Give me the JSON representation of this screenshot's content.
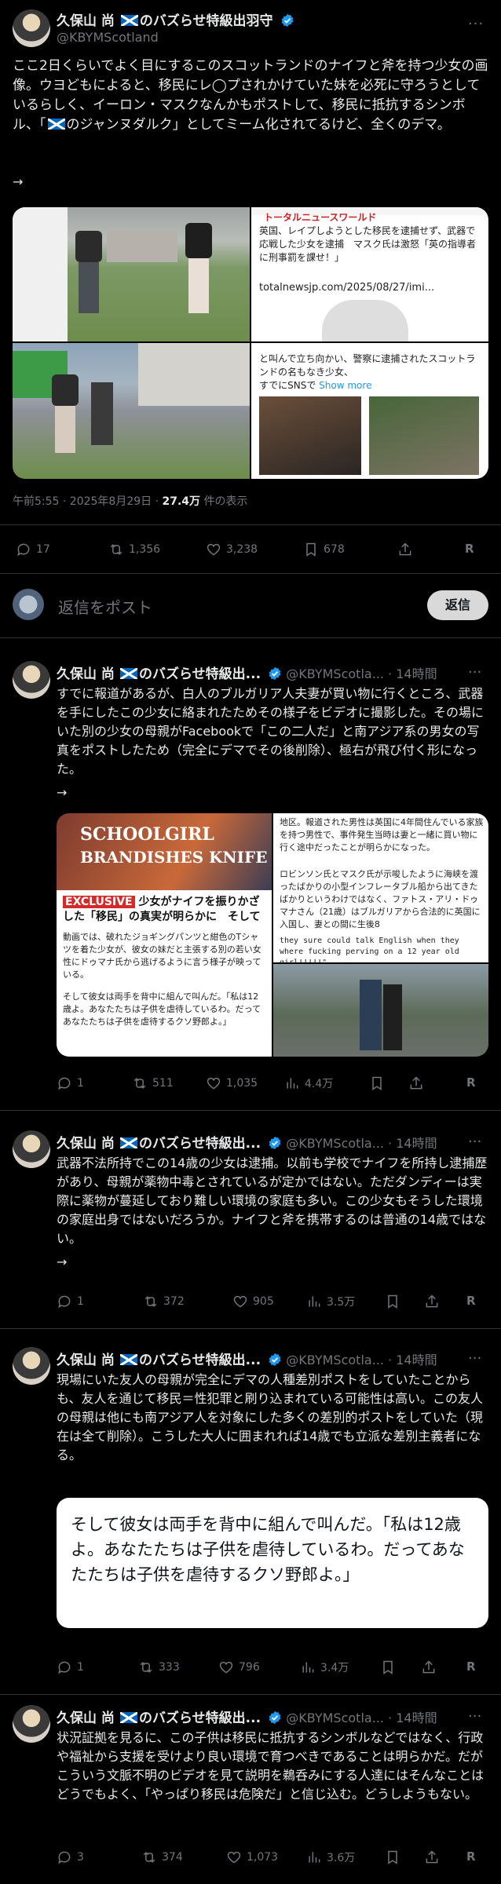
{
  "main_post": {
    "author_name": "久保山 尚 🏴󠁧󠁢󠁳󠁣󠁴󠁿のバズらせ特級出羽守",
    "author_name_plain": "久保山 尚",
    "author_name_suffix": "のバズらせ特級出羽守",
    "handle": "@KBYMScotland",
    "text": "ここ2日くらいでよく目にするこのスコットランドのナイフと斧を持つ少女の画像。ウヨどもによると、移民にレ◯プされかけていた妹を必死に守ろうとしているらしく、イーロン・マスクなんかもポストして、移民に抵抗するシンボル、「🏴󠁧󠁢󠁳󠁣󠁴󠁿のジャンヌダルク」としてミーム化されてるけど、全くのデマ。",
    "text_before_flag": "ここ2日くらいでよく目にするこのスコットランドのナイフと斧を持つ少女の画像。ウヨどもによると、移民にレ◯プされかけていた妹を必死に守ろうとしているらしく、イーロン・マスクなんかもポストして、移民に抵抗するシンボル、「",
    "text_after_flag": "のジャンヌダルク」としてミーム化されてるけど、全くのデマ。",
    "arrow": "→",
    "media_right_top": {
      "header": "トータルニュースワールド",
      "text": "英国、レイプしようとした移民を逮捕せず、武器で応戦した少女を逮捕　マスク氏は激怒「英の指導者に刑事罰を課せ！」",
      "link": "totalnewsjp.com/2025/08/27/imi..."
    },
    "media_right_bottom": {
      "text": "と叫んで立ち向かい、警察に逮捕されたスコットランドの名もなき少女、",
      "text2": "すでにSNSで",
      "show_more": "Show more"
    },
    "time": "午前5:55 · 2025年8月29日 ·",
    "views_count": "27.4万",
    "views_label": "件の表示",
    "stats": {
      "replies": "17",
      "reposts": "1,356",
      "likes": "3,238",
      "bookmarks": "678"
    }
  },
  "reply_box": {
    "placeholder": "返信をポスト",
    "button": "返信"
  },
  "replies": [
    {
      "author_name": "久保山 尚",
      "author_suffix": "のバズらせ特級出...",
      "handle": "@KBYMScotla...",
      "time": "· 14時間",
      "text": "すでに報道があるが、白人のブルガリア人夫妻が買い物に行くところ、武器を手にしたこの少女に絡まれたためその様子をビデオに撮影した。その場にいた別の少女の母親がFacebookで「この二人だ」と南アジア系の男女の写真をポストしたため（完全にデマでその後削除）、極右が飛び付く形になった。",
      "arrow": "→",
      "media": {
        "headline1": "SCHOOLGIRL",
        "headline2": "BRANDISHES KNIFE",
        "exclusive": "EXCLUSIVE",
        "exclusive_text": "少女がナイフを振りかざした「移民」の真実が明らかに　そしてマスクとロビンソ",
        "left_text1": "動画では、破れたジョギングパンツと紺色のTシャツを着た少女が、彼女の妹だと主張する別の若い女性にドゥマナ氏から逃げるように言う様子が映っている。",
        "left_text2": "そして彼女は両手を背中に組んで叫んだ。「私は12歳よ。あなたたちは子供を虐待しているわ。だってあなたたちは子供を虐待するクソ野郎よ。」",
        "right_text1": "地区。報道された男性は英国に4年間住んでいる家族を持つ男性で、事件発生当時は妻と一緒に買い物に行く途中だったことが明らかになった。",
        "right_text2": "ロビンソン氏とマスク氏が示唆したように海峡を渡ったばかりの小型インフレータブル船から出てきたばかりというわけではなく、ファトス・アリ・ドゥマナさん（21歳）はブルガリアから合法的に英国に入国し、妻との間に生後8",
        "right_text3": "they sure could talk English when they where fucking perving on a 12 year old girl!!!!!\""
      },
      "stats": {
        "replies": "1",
        "reposts": "511",
        "likes": "1,035",
        "views": "4.4万"
      }
    },
    {
      "author_name": "久保山 尚",
      "author_suffix": "のバズらせ特級出...",
      "handle": "@KBYMScotla...",
      "time": "· 14時間",
      "text": "武器不法所持でこの14歳の少女は逮捕。以前も学校でナイフを所持し逮捕歴があり、母親が薬物中毒とされているが定かではない。ただダンディーは実際に薬物が蔓延しており難しい環境の家庭も多い。この少女もそうした環境の家庭出身ではないだろうか。ナイフと斧を携帯するのは普通の14歳ではない。",
      "arrow": "→",
      "stats": {
        "replies": "1",
        "reposts": "372",
        "likes": "905",
        "views": "3.5万"
      }
    },
    {
      "author_name": "久保山 尚",
      "author_suffix": "のバズらせ特級出...",
      "handle": "@KBYMScotla...",
      "time": "· 14時間",
      "text": "現場にいた友人の母親が完全にデマの人種差別ポストをしていたことからも、友人を通じて移民＝性犯罪と刷り込まれている可能性は高い。この友人の母親は他にも南アジア人を対象にした多くの差別的ポストをしていた（現在は全て削除）。こうした大人に囲まれれば14歳でも立派な差別主義者になる。",
      "quote": "そして彼女は両手を背中に組んで叫んだ。「私は12歳よ。あなたたちは子供を虐待しているわ。だってあなたたちは子供を虐待するクソ野郎よ。」",
      "stats": {
        "replies": "1",
        "reposts": "333",
        "likes": "796",
        "views": "3.4万"
      }
    },
    {
      "author_name": "久保山 尚",
      "author_suffix": "のバズらせ特級出...",
      "handle": "@KBYMScotla...",
      "time": "· 14時間",
      "text": "状況証拠を見るに、この子供は移民に抵抗するシンボルなどではなく、行政や福祉から支援を受けより良い環境で育つべきであることは明らかだ。だがこういう文脈不明のビデオを見て説明を鵜呑みにする人達にはそんなことはどうでもよく、「やっぱり移民は危険だ」と信じ込む。どうしようもない。",
      "stats": {
        "replies": "3",
        "reposts": "374",
        "likes": "1,073",
        "views": "3.6万"
      }
    }
  ],
  "colors": {
    "background": "#000000",
    "text": "#e7e9ea",
    "muted": "#71767b",
    "divider": "#2f3336",
    "verified": "#1d9bf0",
    "link": "#1d9bf0"
  }
}
